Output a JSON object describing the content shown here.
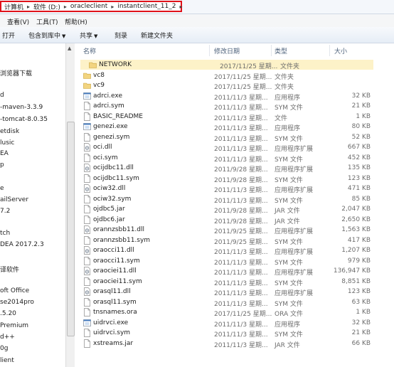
{
  "address": {
    "crumbs": [
      "计算机",
      "软件 (D:)",
      "oracleclient",
      "instantclient_11_2"
    ]
  },
  "menu": {
    "items": [
      "查看(V)",
      "工具(T)",
      "帮助(H)"
    ]
  },
  "toolbar": {
    "open": "打开",
    "include_library": "包含到库中",
    "share": "共享",
    "burn": "刻录",
    "new_folder": "新建文件夹"
  },
  "nav": {
    "items": [
      "浏览器下载",
      "d",
      "-maven-3.3.9",
      "-tomcat-8.0.35",
      "etdisk",
      "lusic",
      "EA",
      "p",
      "e",
      "ailServer",
      " 7.2",
      "tch",
      "DEA 2017.2.3",
      "译软件",
      "oft Office",
      "se2014pro",
      ".5.20",
      " Premium",
      "d++",
      "0g",
      "lient"
    ]
  },
  "headers": {
    "name": "名称",
    "date": "修改日期",
    "type": "类型",
    "size": "大小"
  },
  "files": [
    {
      "name": "NETWORK",
      "date": "2017/11/25 星期...",
      "type": "文件夹",
      "size": "",
      "icon": "folder-icon"
    },
    {
      "name": "vc8",
      "date": "2017/11/25 星期...",
      "type": "文件夹",
      "size": "",
      "icon": "folder-icon"
    },
    {
      "name": "vc9",
      "date": "2017/11/25 星期...",
      "type": "文件夹",
      "size": "",
      "icon": "folder-icon"
    },
    {
      "name": "adrci.exe",
      "date": "2011/11/3 星期...",
      "type": "应用程序",
      "size": "32 KB",
      "icon": "exe-icon"
    },
    {
      "name": "adrci.sym",
      "date": "2011/11/3 星期...",
      "type": "SYM 文件",
      "size": "21 KB",
      "icon": "file-icon"
    },
    {
      "name": "BASIC_README",
      "date": "2011/11/3 星期...",
      "type": "文件",
      "size": "1 KB",
      "icon": "file-icon"
    },
    {
      "name": "genezi.exe",
      "date": "2011/11/3 星期...",
      "type": "应用程序",
      "size": "80 KB",
      "icon": "exe-icon"
    },
    {
      "name": "genezi.sym",
      "date": "2011/11/3 星期...",
      "type": "SYM 文件",
      "size": "52 KB",
      "icon": "file-icon"
    },
    {
      "name": "oci.dll",
      "date": "2011/11/3 星期...",
      "type": "应用程序扩展",
      "size": "667 KB",
      "icon": "dll-icon"
    },
    {
      "name": "oci.sym",
      "date": "2011/11/3 星期...",
      "type": "SYM 文件",
      "size": "452 KB",
      "icon": "file-icon"
    },
    {
      "name": "ocijdbc11.dll",
      "date": "2011/9/28 星期...",
      "type": "应用程序扩展",
      "size": "135 KB",
      "icon": "dll-icon"
    },
    {
      "name": "ocijdbc11.sym",
      "date": "2011/9/28 星期...",
      "type": "SYM 文件",
      "size": "123 KB",
      "icon": "file-icon"
    },
    {
      "name": "ociw32.dll",
      "date": "2011/11/3 星期...",
      "type": "应用程序扩展",
      "size": "471 KB",
      "icon": "dll-icon"
    },
    {
      "name": "ociw32.sym",
      "date": "2011/11/3 星期...",
      "type": "SYM 文件",
      "size": "85 KB",
      "icon": "file-icon"
    },
    {
      "name": "ojdbc5.jar",
      "date": "2011/9/28 星期...",
      "type": "JAR 文件",
      "size": "2,047 KB",
      "icon": "file-icon"
    },
    {
      "name": "ojdbc6.jar",
      "date": "2011/9/28 星期...",
      "type": "JAR 文件",
      "size": "2,650 KB",
      "icon": "file-icon"
    },
    {
      "name": "orannzsbb11.dll",
      "date": "2011/9/25 星期...",
      "type": "应用程序扩展",
      "size": "1,563 KB",
      "icon": "dll-icon"
    },
    {
      "name": "orannzsbb11.sym",
      "date": "2011/9/25 星期...",
      "type": "SYM 文件",
      "size": "417 KB",
      "icon": "file-icon"
    },
    {
      "name": "oraocci11.dll",
      "date": "2011/11/3 星期...",
      "type": "应用程序扩展",
      "size": "1,207 KB",
      "icon": "dll-icon"
    },
    {
      "name": "oraocci11.sym",
      "date": "2011/11/3 星期...",
      "type": "SYM 文件",
      "size": "979 KB",
      "icon": "file-icon"
    },
    {
      "name": "oraociei11.dll",
      "date": "2011/11/3 星期...",
      "type": "应用程序扩展",
      "size": "136,947 KB",
      "icon": "dll-icon"
    },
    {
      "name": "oraociei11.sym",
      "date": "2011/11/3 星期...",
      "type": "SYM 文件",
      "size": "8,851 KB",
      "icon": "file-icon"
    },
    {
      "name": "orasql11.dll",
      "date": "2011/11/3 星期...",
      "type": "应用程序扩展",
      "size": "123 KB",
      "icon": "dll-icon"
    },
    {
      "name": "orasql11.sym",
      "date": "2011/11/3 星期...",
      "type": "SYM 文件",
      "size": "63 KB",
      "icon": "file-icon"
    },
    {
      "name": "tnsnames.ora",
      "date": "2017/11/25 星期...",
      "type": "ORA 文件",
      "size": "1 KB",
      "icon": "file-icon"
    },
    {
      "name": "uidrvci.exe",
      "date": "2011/11/3 星期...",
      "type": "应用程序",
      "size": "32 KB",
      "icon": "exe-icon"
    },
    {
      "name": "uidrvci.sym",
      "date": "2011/11/3 星期...",
      "type": "SYM 文件",
      "size": "21 KB",
      "icon": "file-icon"
    },
    {
      "name": "xstreams.jar",
      "date": "2011/11/3 星期...",
      "type": "JAR 文件",
      "size": "66 KB",
      "icon": "file-icon"
    }
  ]
}
